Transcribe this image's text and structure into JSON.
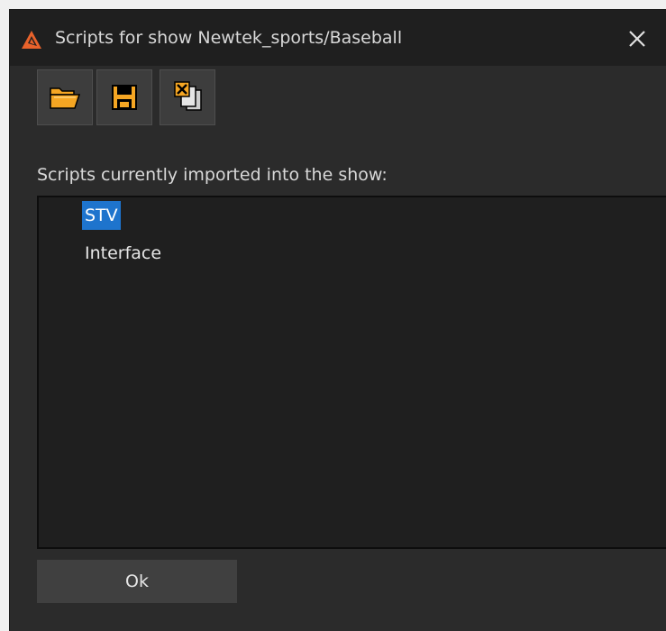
{
  "window": {
    "title": "Scripts for show Newtek_sports/Baseball"
  },
  "toolbar": {
    "buttons": [
      {
        "icon": "open-folder-icon"
      },
      {
        "icon": "save-icon"
      },
      {
        "icon": "remove-script-icon"
      }
    ],
    "accent_color": "#f5a623"
  },
  "scripts_section": {
    "label": "Scripts currently imported into the show:",
    "items": [
      {
        "label": "STV",
        "selected": true
      },
      {
        "label": "Interface",
        "selected": false
      }
    ],
    "selection_color": "#1e74cd"
  },
  "footer": {
    "ok_label": "Ok"
  }
}
